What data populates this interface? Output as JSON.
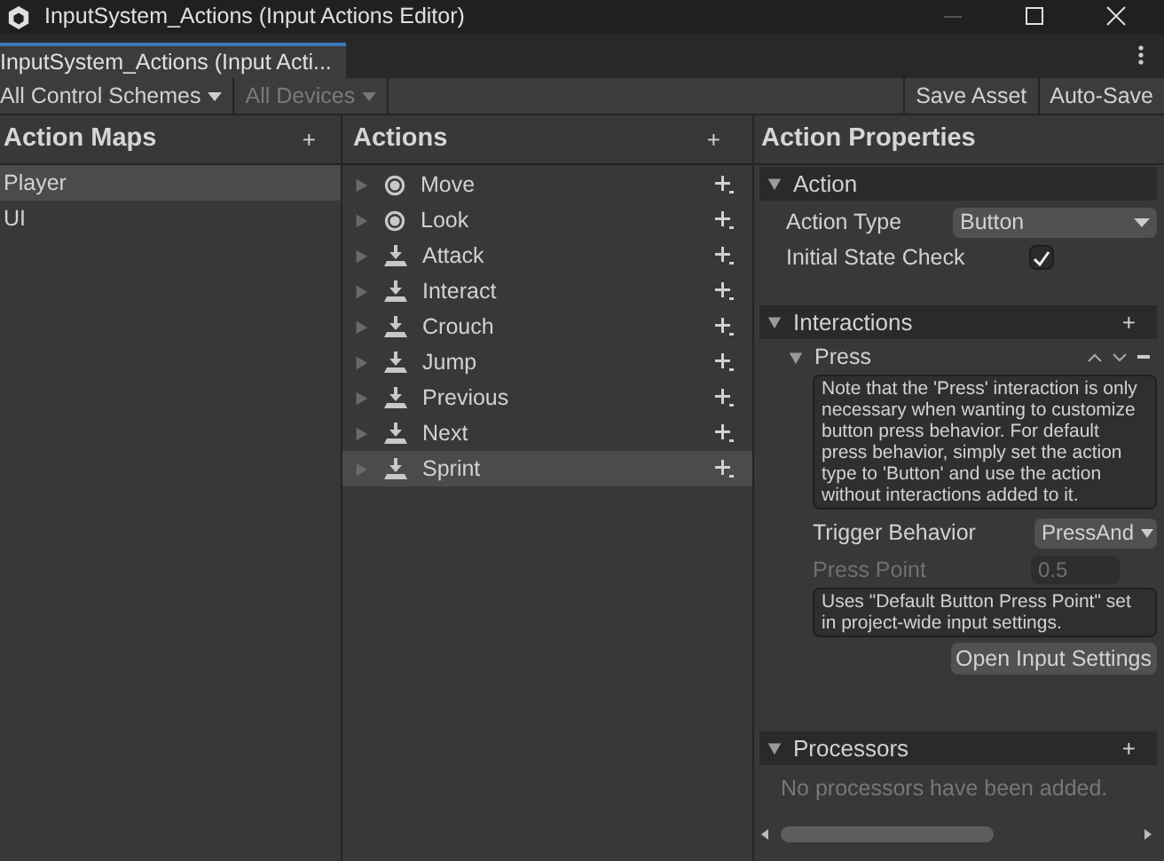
{
  "window": {
    "title": "InputSystem_Actions (Input Actions Editor)"
  },
  "tab": {
    "label": "InputSystem_Actions (Input Acti...",
    "selected": true
  },
  "toolbar": {
    "control_schemes": "All Control Schemes",
    "devices": {
      "label": "All Devices",
      "disabled": true
    },
    "save_asset": "Save Asset",
    "auto_save": "Auto-Save"
  },
  "action_maps": {
    "title": "Action Maps",
    "add": "+",
    "items": [
      {
        "label": "Player",
        "selected": true
      },
      {
        "label": "UI",
        "selected": false
      }
    ]
  },
  "actions": {
    "title": "Actions",
    "add": "+",
    "items": [
      {
        "label": "Move",
        "kind": "value",
        "selected": false
      },
      {
        "label": "Look",
        "kind": "value",
        "selected": false
      },
      {
        "label": "Attack",
        "kind": "button",
        "selected": false
      },
      {
        "label": "Interact",
        "kind": "button",
        "selected": false
      },
      {
        "label": "Crouch",
        "kind": "button",
        "selected": false
      },
      {
        "label": "Jump",
        "kind": "button",
        "selected": false
      },
      {
        "label": "Previous",
        "kind": "button",
        "selected": false
      },
      {
        "label": "Next",
        "kind": "button",
        "selected": false
      },
      {
        "label": "Sprint",
        "kind": "button",
        "selected": true
      }
    ]
  },
  "properties": {
    "title": "Action Properties",
    "action": {
      "title": "Action",
      "expanded": true,
      "action_type_label": "Action Type",
      "action_type": "Button",
      "initial_state_label": "Initial State Check",
      "initial_state_checked": true
    },
    "interactions": {
      "title": "Interactions",
      "add": "+",
      "expanded": true,
      "items": [
        {
          "title": "Press",
          "expanded": true,
          "note": "Note that the 'Press' interaction is only necessary when wanting to customize button press behavior. For default press behavior, simply set the action type to 'Button' and use the action without interactions added to it.",
          "trigger_label": "Trigger Behavior",
          "trigger_value": "PressAnd",
          "press_point_label": "Press Point",
          "press_point_value": "0.5",
          "press_point_disabled": true,
          "help": "Uses \"Default Button Press Point\" set in project-wide input settings.",
          "open_settings": "Open Input Settings"
        }
      ]
    },
    "processors": {
      "title": "Processors",
      "add": "+",
      "expanded": true,
      "empty": "No processors have been added."
    }
  }
}
